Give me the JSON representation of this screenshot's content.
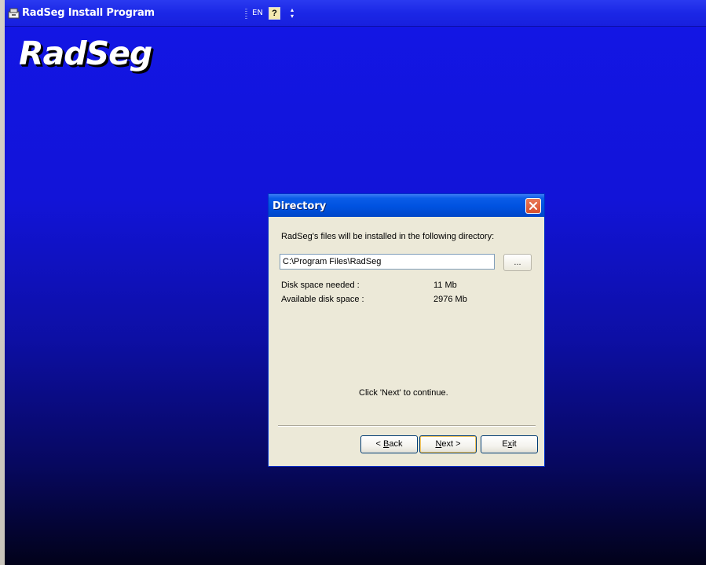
{
  "window": {
    "title": "RadSeg Install Program",
    "language_code": "EN",
    "logo_text": "RadSeg"
  },
  "dialog": {
    "title": "Directory",
    "install_message": "RadSeg's files will be installed in the following directory:",
    "install_path": "C:\\Program Files\\RadSeg",
    "browse_label": "...",
    "disk_space_needed_label": "Disk space needed :",
    "disk_space_needed_value": "11 Mb",
    "available_disk_space_label": "Available disk space :",
    "available_disk_space_value": "2976 Mb",
    "continue_message": "Click 'Next' to continue.",
    "buttons": {
      "back": {
        "prefix": "< ",
        "hotkey": "B",
        "rest": "ack"
      },
      "next": {
        "hotkey": "N",
        "rest": "ext >"
      },
      "exit": {
        "prefix": "E",
        "hotkey": "x",
        "rest": "it"
      }
    }
  },
  "icons": {
    "app": "installer-icon",
    "help": "help-icon",
    "close": "close-icon",
    "language_options": "options-arrow-icon"
  },
  "colors": {
    "desktop_top": "#1316e6",
    "desktop_bottom": "#02021a",
    "dialog_title": "#0052e0",
    "dialog_face": "#ece9d8",
    "close_button": "#d84f2c"
  }
}
